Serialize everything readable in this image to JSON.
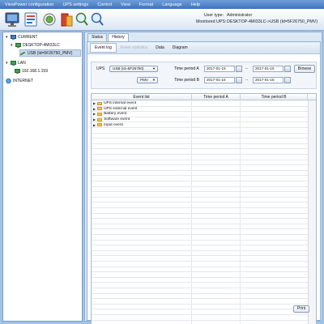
{
  "menu": [
    "ViewPower configuration",
    "UPS settings",
    "Control",
    "View",
    "Format",
    "Language",
    "Help"
  ],
  "toolbar": {
    "icons": [
      "monitor-icon",
      "config-icon",
      "control-icon",
      "ups-icon",
      "search-icon",
      "zoom-icon"
    ]
  },
  "user": {
    "type_label": "User type:",
    "type_value": "Administrator",
    "ups_label": "Monitored UPS:",
    "ups_value": "DESKTOP-4MI33LC->USB (Id=5F26750_PMV)"
  },
  "tree": {
    "current": "CURRENT",
    "desktop": "DESKTOP-4MI33LC",
    "usb": "USB (Id=5F26750_PMV)",
    "lan": "LAN",
    "ip": "192.168.1.159",
    "internet": "INTERNET"
  },
  "tabs": [
    "Status",
    "History"
  ],
  "subtabs": [
    "Event log",
    "Event statistics",
    "Data",
    "Diagram"
  ],
  "filter": {
    "ups_label": "UPS",
    "ups_value": "USB (Id=5F26750)",
    "model_value": "PMV",
    "period_a_label": "Time period A",
    "period_b_label": "Time period B",
    "a_from": "2017-01-15",
    "a_to": "2017-01-15",
    "b_from": "2017-01-15",
    "b_to": "2017-01-15",
    "dash": "--",
    "browse": "Browse"
  },
  "grid": {
    "headers": [
      "Event list",
      "Time period A",
      "Time period B"
    ],
    "rows": [
      "UPS internal event",
      "UPS external event",
      "Battery event",
      "Software event",
      "Input event"
    ]
  },
  "print_label": "Print"
}
